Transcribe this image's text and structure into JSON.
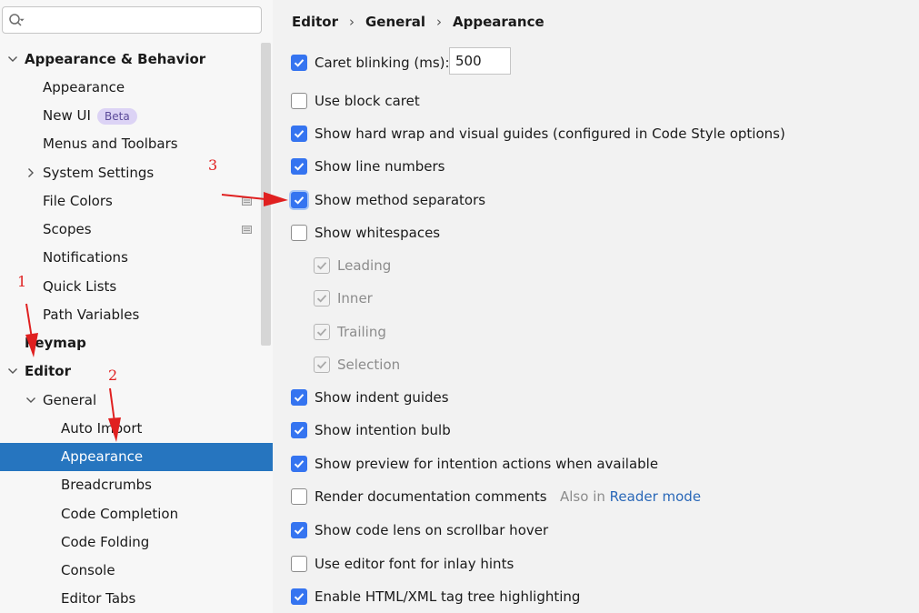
{
  "search": {
    "placeholder": "",
    "value": ""
  },
  "sidebar": {
    "items": [
      {
        "label": "Appearance & Behavior",
        "level": 0,
        "expanded": true,
        "bold": true
      },
      {
        "label": "Appearance",
        "level": 1
      },
      {
        "label": "New UI",
        "level": 1,
        "badge": "Beta"
      },
      {
        "label": "Menus and Toolbars",
        "level": 1
      },
      {
        "label": "System Settings",
        "level": 1,
        "expanded": false
      },
      {
        "label": "File Colors",
        "level": 1,
        "icon": "project-icon"
      },
      {
        "label": "Scopes",
        "level": 1,
        "icon": "project-icon"
      },
      {
        "label": "Notifications",
        "level": 1
      },
      {
        "label": "Quick Lists",
        "level": 1
      },
      {
        "label": "Path Variables",
        "level": 1
      },
      {
        "label": "Keymap",
        "level": 0,
        "bold": true
      },
      {
        "label": "Editor",
        "level": 0,
        "expanded": true,
        "bold": true
      },
      {
        "label": "General",
        "level": 1,
        "expanded": true
      },
      {
        "label": "Auto Import",
        "level": 2
      },
      {
        "label": "Appearance",
        "level": 2,
        "selected": true
      },
      {
        "label": "Breadcrumbs",
        "level": 2
      },
      {
        "label": "Code Completion",
        "level": 2
      },
      {
        "label": "Code Folding",
        "level": 2
      },
      {
        "label": "Console",
        "level": 2
      },
      {
        "label": "Editor Tabs",
        "level": 2
      }
    ]
  },
  "breadcrumb": [
    "Editor",
    "General",
    "Appearance"
  ],
  "options": {
    "caret_blinking": {
      "label": "Caret blinking (ms):",
      "checked": true,
      "value": "500"
    },
    "block_caret": {
      "label": "Use block caret",
      "checked": false
    },
    "hard_wrap": {
      "label": "Show hard wrap and visual guides (configured in Code Style options)",
      "checked": true
    },
    "line_numbers": {
      "label": "Show line numbers",
      "checked": true
    },
    "method_separators": {
      "label": "Show method separators",
      "checked": true
    },
    "whitespaces": {
      "label": "Show whitespaces",
      "checked": false
    },
    "leading": {
      "label": "Leading",
      "checked": true,
      "disabled": true
    },
    "inner": {
      "label": "Inner",
      "checked": true,
      "disabled": true
    },
    "trailing": {
      "label": "Trailing",
      "checked": true,
      "disabled": true
    },
    "selection": {
      "label": "Selection",
      "checked": true,
      "disabled": true
    },
    "indent_guides": {
      "label": "Show indent guides",
      "checked": true
    },
    "intention_bulb": {
      "label": "Show intention bulb",
      "checked": true
    },
    "preview_intention": {
      "label": "Show preview for intention actions when available",
      "checked": true
    },
    "render_docs": {
      "label": "Render documentation comments",
      "checked": false,
      "hint_prefix": "Also in",
      "hint_link": "Reader mode"
    },
    "code_lens": {
      "label": "Show code lens on scrollbar hover",
      "checked": true
    },
    "editor_font_inlay": {
      "label": "Use editor font for inlay hints",
      "checked": false
    },
    "tag_tree": {
      "label": "Enable HTML/XML tag tree highlighting",
      "checked": true
    }
  },
  "annotations": [
    "1",
    "2",
    "3"
  ],
  "colors": {
    "accent": "#3574f0",
    "selection": "#2675bf",
    "annotation": "#e02020"
  }
}
